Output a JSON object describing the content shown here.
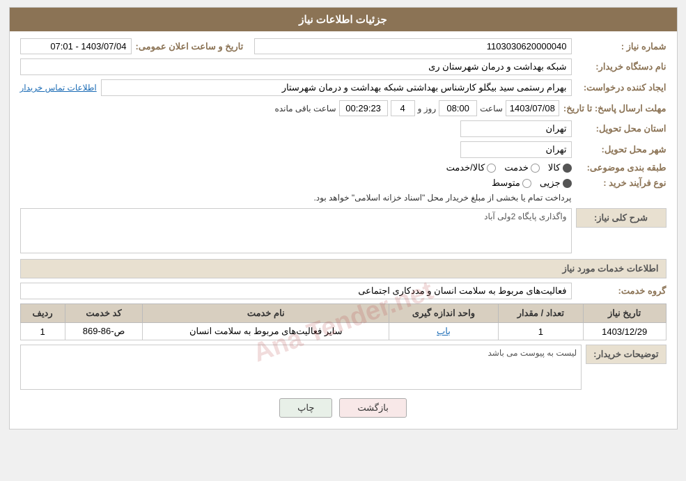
{
  "header": {
    "title": "جزئیات اطلاعات نیاز"
  },
  "fields": {
    "need_number_label": "شماره نیاز :",
    "need_number_value": "1103030620000040",
    "buyer_org_label": "نام دستگاه خریدار:",
    "buyer_org_value": "شبکه بهداشت و درمان شهرستان ری",
    "created_by_label": "ایجاد کننده درخواست:",
    "created_by_value": "بهرام رستمی سید بیگلو کارشناس بهداشتی شبکه بهداشت و درمان شهرستار",
    "contact_link": "اطلاعات تماس خریدار",
    "announce_date_label": "تاریخ و ساعت اعلان عمومی:",
    "announce_date_value": "1403/07/04 - 07:01",
    "response_deadline_label": "مهلت ارسال پاسخ: تا تاریخ:",
    "response_date": "1403/07/08",
    "response_time_label": "ساعت",
    "response_time": "08:00",
    "days_label": "روز و",
    "days_value": "4",
    "remaining_label": "ساعت باقی مانده",
    "remaining_value": "00:29:23",
    "province_label": "استان محل تحویل:",
    "province_value": "تهران",
    "city_label": "شهر محل تحویل:",
    "city_value": "تهران",
    "category_label": "طبقه بندی موضوعی:",
    "category_goods": "کالا",
    "category_service": "خدمت",
    "category_goods_service": "کالا/خدمت",
    "purchase_type_label": "نوع فرآیند خرید :",
    "purchase_type_partial": "جزیی",
    "purchase_type_medium": "متوسط",
    "purchase_type_note": "پرداخت تمام یا بخشی از مبلغ خریدار محل \"اسناد خزانه اسلامی\" خواهد بود.",
    "need_summary_section": "شرح کلی نیاز:",
    "need_summary_value": "واگذاری پایگاه 2ولی آباد",
    "services_section": "اطلاعات خدمات مورد نیاز",
    "service_group_label": "گروه خدمت:",
    "service_group_value": "فعالیت‌های مربوط به سلامت انسان و مددکاری اجتماعی",
    "table_headers": {
      "row_num": "ردیف",
      "service_code": "کد خدمت",
      "service_name": "نام خدمت",
      "unit": "واحد اندازه گیری",
      "quantity": "تعداد / مقدار",
      "date": "تاریخ نیاز"
    },
    "table_rows": [
      {
        "row_num": "1",
        "service_code": "ص-86-869",
        "service_name": "سایر فعالیت‌های مربوط به سلامت انسان",
        "unit": "باب",
        "quantity": "1",
        "date": "1403/12/29"
      }
    ],
    "buyer_notes_label": "توضیحات خریدار:",
    "buyer_notes_value": "لیست به پیوست می باشد"
  },
  "buttons": {
    "print_label": "چاپ",
    "back_label": "بازگشت"
  },
  "watermark": "Ana Tender.net"
}
